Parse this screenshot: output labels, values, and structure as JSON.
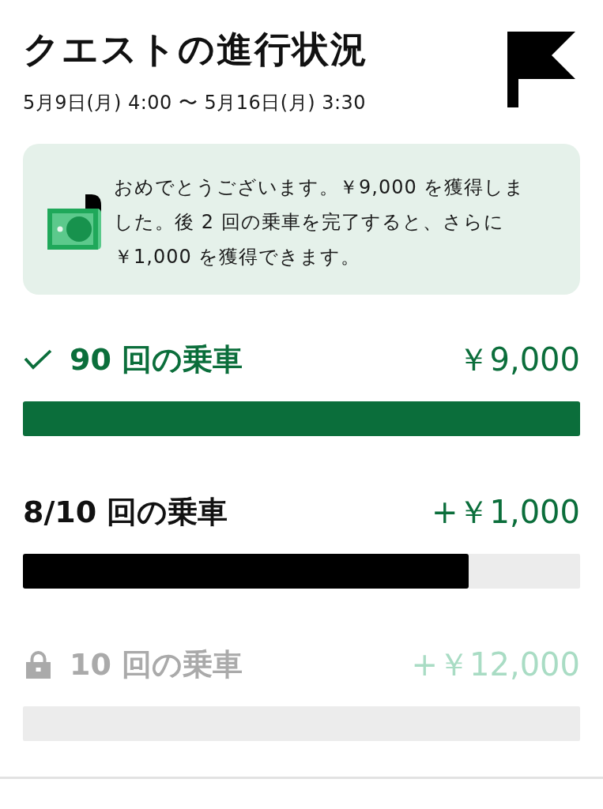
{
  "header": {
    "title": "クエストの進行状況",
    "period": "5月9日(月) 4:00 〜 5月16日(月) 3:30"
  },
  "notice": {
    "message": "おめでとうございます。￥9,000 を獲得しました。後 2 回の乗車を完了すると、さらに￥1,000 を獲得できます。"
  },
  "tiers": [
    {
      "kind": "completed",
      "label": "90 回の乗車",
      "reward": "￥9,000",
      "level": 1
    },
    {
      "kind": "current",
      "label": "8/10 回の乗車",
      "reward": "+￥1,000",
      "level": 0.8
    },
    {
      "kind": "locked",
      "label": "10 回の乗車",
      "reward": "+￥12,000",
      "level": 0
    }
  ]
}
